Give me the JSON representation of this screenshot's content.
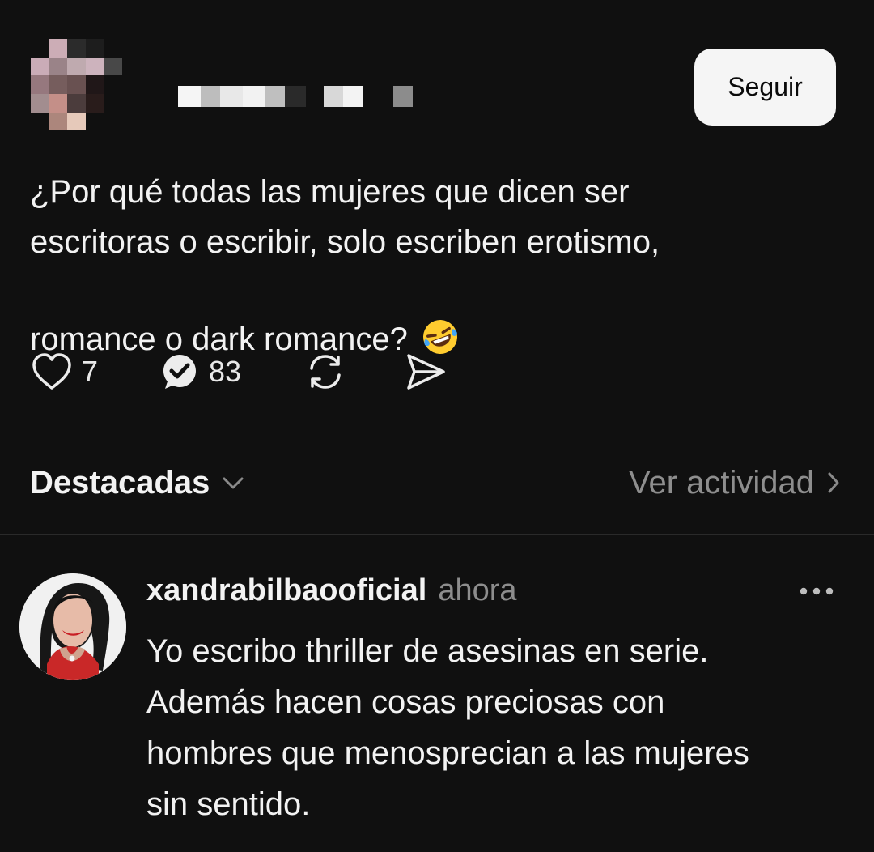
{
  "post": {
    "follow_label": "Seguir",
    "text": "¿Por qué todas las mujeres que dicen ser\nescritoras o escribir, solo escriben erotismo,\nromance o dark romance?",
    "emoji": "rolling-on-the-floor-laughing",
    "likes": "7",
    "replies": "83"
  },
  "sort": {
    "label": "Destacadas",
    "activity_label": "Ver actividad"
  },
  "comment": {
    "username": "xandrabilbaooficial",
    "time": "ahora",
    "text": "Yo escribo thriller de asesinas  en serie.\nAdemás hacen cosas preciosas con\nhombres que menosprecian a las mujeres\nsin sentido."
  },
  "colors": {
    "background": "#101010",
    "text_primary": "#f2f2f2",
    "text_secondary": "#8e8e8e",
    "button_background": "#f5f5f5",
    "emoji_yellow": "#ffcc2f"
  }
}
